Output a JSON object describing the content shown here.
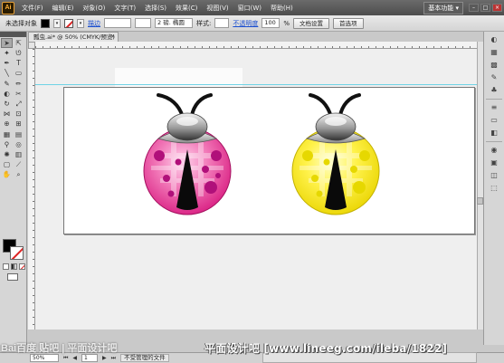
{
  "app": {
    "logo": "Ai"
  },
  "menu": [
    "文件(F)",
    "编辑(E)",
    "对象(O)",
    "文字(T)",
    "选择(S)",
    "效果(C)",
    "视图(V)",
    "窗口(W)",
    "帮助(H)"
  ],
  "workspace": "基本功能 ▾",
  "control": {
    "no_selection": "未选择对象",
    "stroke_label": "描边",
    "brush": "2 磅. 椭圆",
    "style_label": "样式:",
    "opacity_label": "不透明度",
    "opacity_value": "100",
    "opacity_unit": "%",
    "doc_setup": "文档设置",
    "preferences": "首选项"
  },
  "document": {
    "tab_title": "瓢虫.ai* @ 50% (CMYK/预览)",
    "close": "×"
  },
  "status": {
    "zoom": "50%",
    "page": "1",
    "status_text": "不受管理的文件"
  },
  "watermark": {
    "left": "Bai百度 贴吧 | 平面设计吧",
    "right": "平面设计吧 [www.lineeg.com/ileba/1822]"
  },
  "illustration": {
    "ladybug_colors": [
      "#ea3f9b",
      "#f4ea1c"
    ],
    "spot_colors": [
      "#b0107a",
      "#e6d800"
    ]
  }
}
